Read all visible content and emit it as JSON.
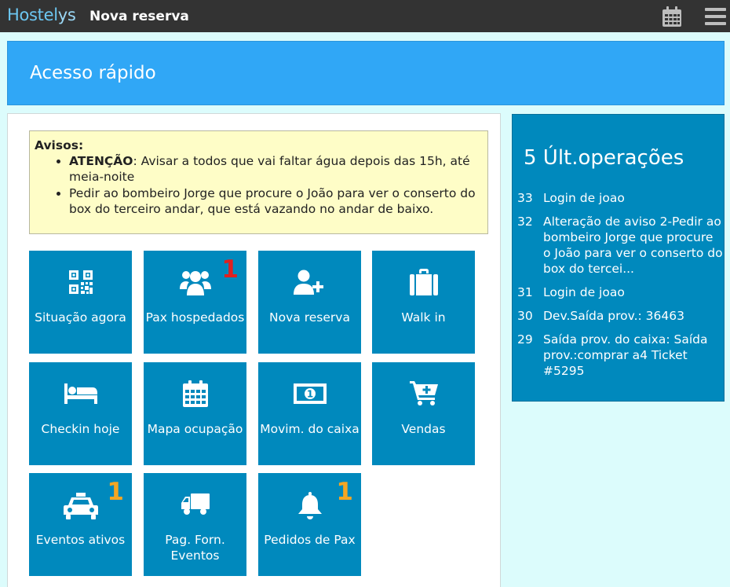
{
  "header": {
    "brand_part1": "Hostel",
    "brand_part2": "ys",
    "page_title": "Nova reserva"
  },
  "banner": {
    "title": "Acesso rápido"
  },
  "notice": {
    "title": "Avisos:",
    "items": [
      {
        "strong": "ATENÇÃO",
        "text": ": Avisar a todos que vai faltar água depois das 15h, até meia-noite"
      },
      {
        "strong": "",
        "text": "Pedir ao bombeiro Jorge que procure o João para ver o conserto do box do terceiro andar, que está vazando no andar de baixo."
      }
    ]
  },
  "tiles": [
    {
      "label": "Situação agora",
      "icon": "qr-code-icon",
      "badge": ""
    },
    {
      "label": "Pax hospedados",
      "icon": "users-icon",
      "badge": "1"
    },
    {
      "label": "Nova reserva",
      "icon": "user-plus-icon",
      "badge": ""
    },
    {
      "label": "Walk in",
      "icon": "suitcase-icon",
      "badge": ""
    },
    {
      "label": "Checkin hoje",
      "icon": "bed-icon",
      "badge": ""
    },
    {
      "label": "Mapa ocupação",
      "icon": "calendar-icon",
      "badge": ""
    },
    {
      "label": "Movim. do caixa",
      "icon": "money-icon",
      "badge": ""
    },
    {
      "label": "Vendas",
      "icon": "cart-plus-icon",
      "badge": ""
    },
    {
      "label": "Eventos ativos",
      "icon": "taxi-icon",
      "badge": "1"
    },
    {
      "label": "Pag. Forn. Eventos",
      "icon": "truck-icon",
      "badge": ""
    },
    {
      "label": "Pedidos de Pax",
      "icon": "bell-icon",
      "badge": "1"
    }
  ],
  "operations": {
    "title": "5 Últ.operações",
    "items": [
      {
        "num": "33",
        "text": "Login de joao"
      },
      {
        "num": "32",
        "text": "Alteração de aviso 2-Pedir ao bombeiro Jorge que procure o João para ver o conserto do box do tercei..."
      },
      {
        "num": "31",
        "text": "Login de joao"
      },
      {
        "num": "30",
        "text": "Dev.Saída prov.: 36463"
      },
      {
        "num": "29",
        "text": "Saída prov. do caixa: Saída prov.:comprar a4 Ticket #5295"
      }
    ]
  },
  "colors": {
    "tile": "#0089bd",
    "banner": "#30a7f6",
    "badge_red": "#e02020",
    "badge_orange": "#f5a623"
  }
}
